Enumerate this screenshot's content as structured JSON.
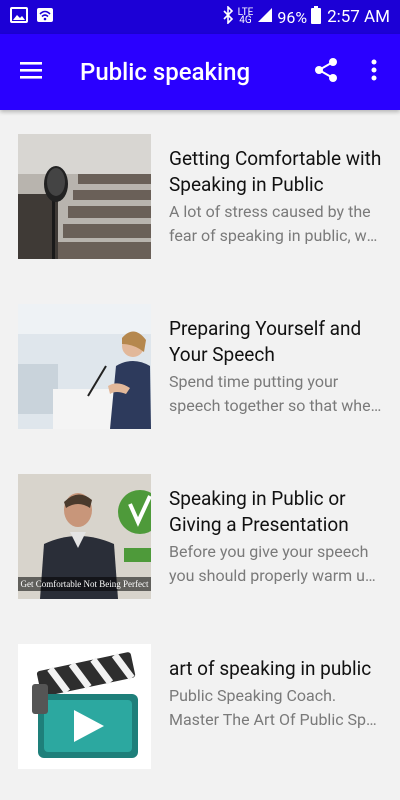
{
  "status": {
    "battery": "96%",
    "time": "2:57 AM",
    "network": "LTE",
    "network_sub": "4G"
  },
  "appbar": {
    "title": "Public speaking"
  },
  "items": [
    {
      "title_line1": "Getting Comfortable with",
      "title_line2": "Speaking in Public",
      "desc_line1": "A lot of stress caused by the",
      "desc_line2": "fear of speaking in public, wh..."
    },
    {
      "title_line1": "Preparing Yourself and",
      "title_line2": "Your Speech",
      "desc_line1": "Spend time putting your",
      "desc_line2": "speech together so that whe..."
    },
    {
      "title_line1": "Speaking in Public or",
      "title_line2": "Giving a Presentation",
      "desc_line1": "Before you give your speech",
      "desc_line2": "you should properly warm up...",
      "thumb_caption": "Get Comfortable Not Being Perfect"
    },
    {
      "title_line1": "art of speaking in public",
      "title_line2": "",
      "desc_line1": "Public Speaking Coach.",
      "desc_line2": "Master The Art Of Public Spe..."
    }
  ],
  "colors": {
    "statusbar": "#1c00d6",
    "appbar": "#2a00ff",
    "background": "#f2f2f2"
  }
}
